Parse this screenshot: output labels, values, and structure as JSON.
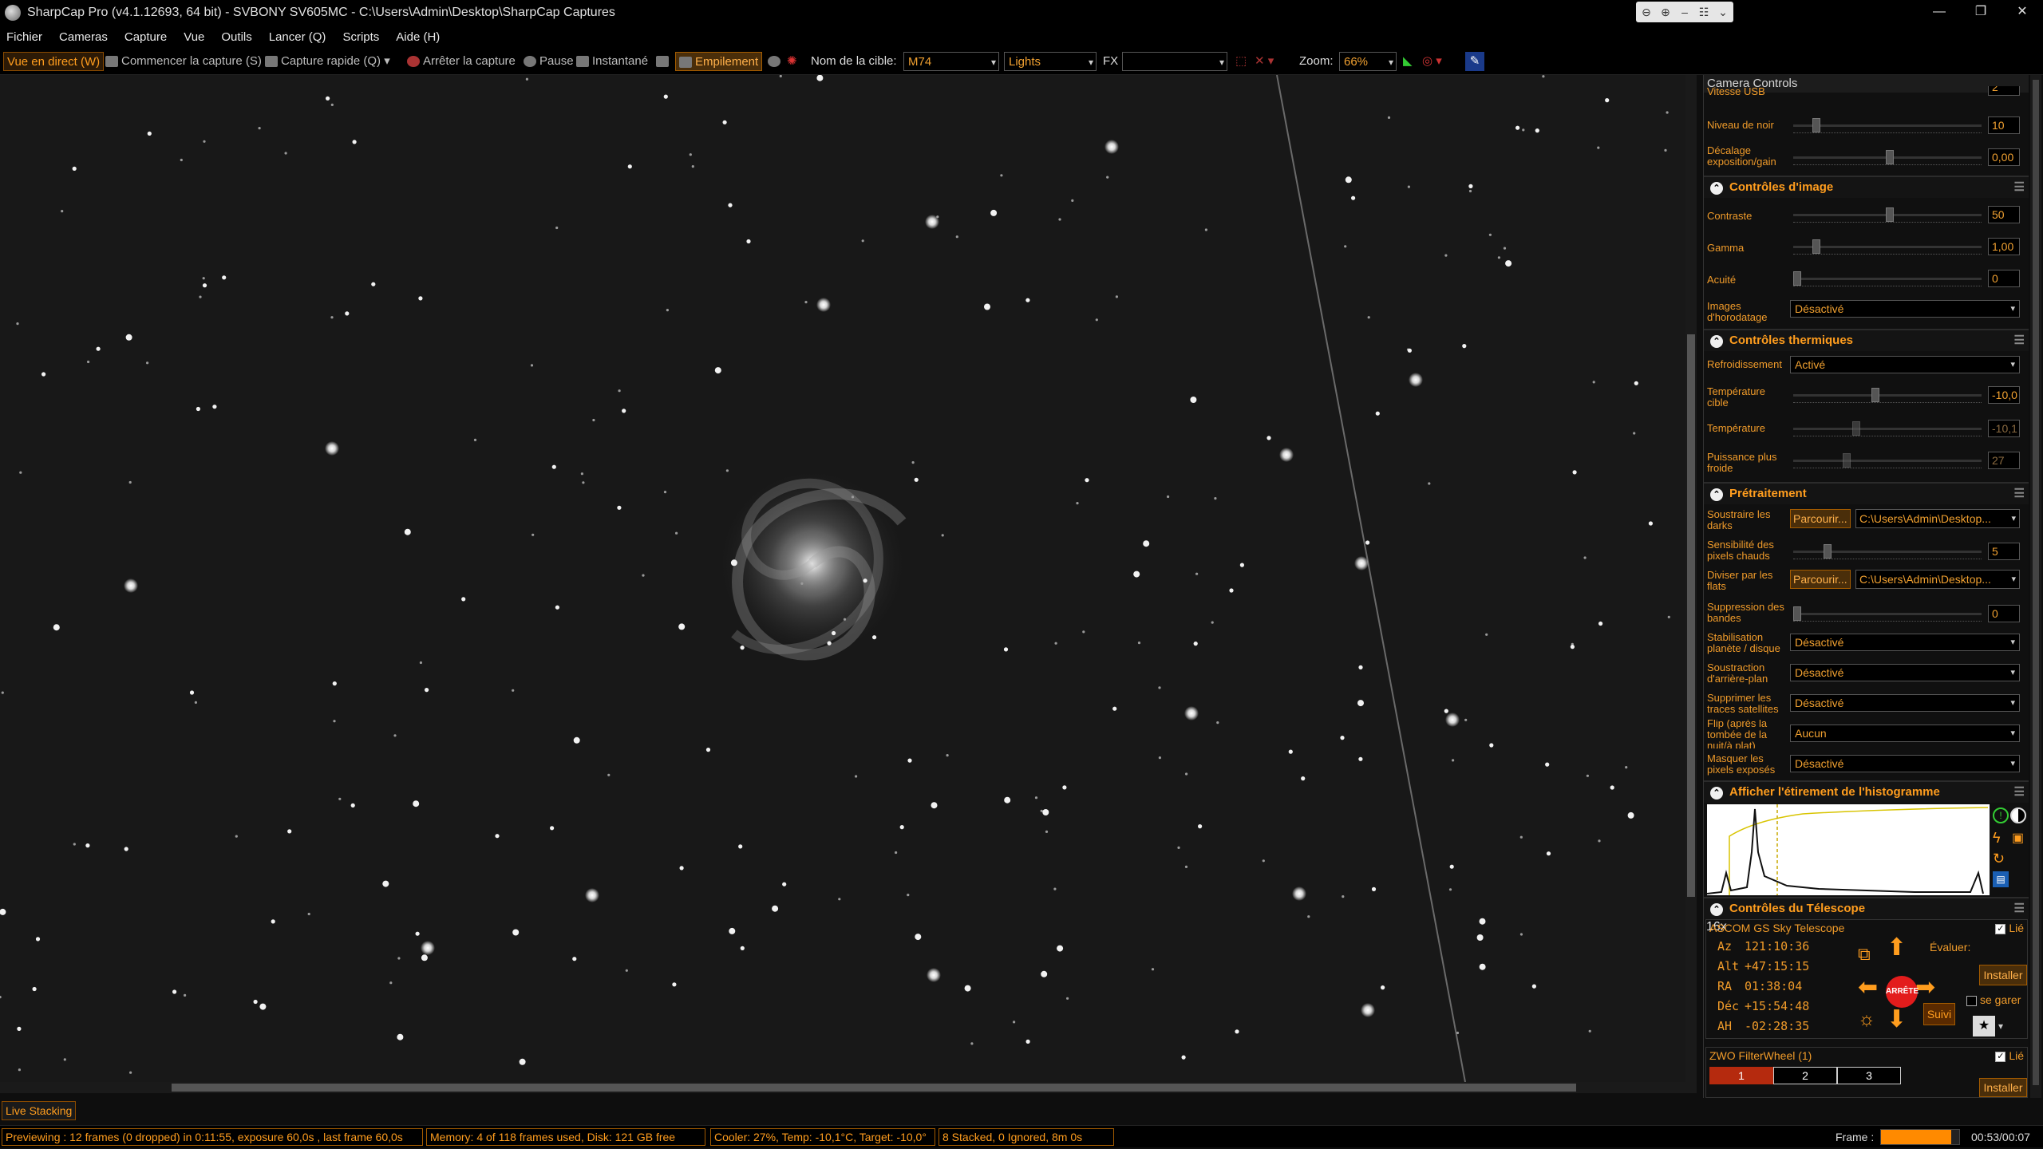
{
  "window": {
    "title": "SharpCap Pro (v4.1.12693, 64 bit) - SVBONY SV605MC - C:\\Users\\Admin\\Desktop\\SharpCap Captures",
    "controls": [
      "—",
      "❐",
      "✕"
    ]
  },
  "menu": [
    "Fichier",
    "Cameras",
    "Capture",
    "Vue",
    "Outils",
    "Lancer (Q)",
    "Scripts",
    "Aide (H)"
  ],
  "toolbar": {
    "live_view": "Vue en direct (W)",
    "start_capture": "Commencer la capture (S)",
    "quick_capture": "Capture rapide (Q)",
    "stop_capture": "Arrêter la capture",
    "pause": "Pause",
    "snapshot": "Instantané",
    "stacking": "Empilement",
    "target_label": "Nom de la cible:",
    "target_value": "M74",
    "frame_type": "Lights",
    "fx_label": "FX",
    "fx_value": "",
    "zoom_label": "Zoom:",
    "zoom_value": "66%"
  },
  "panel": {
    "title": "Camera Controls",
    "cut_off_label": "Vitesse USB",
    "cut_off_value": "2",
    "noir_label": "Niveau de noir",
    "noir_value": "10",
    "offset_label": "Décalage exposition/gain",
    "offset_value": "0,00",
    "image": {
      "header": "Contrôles d'image",
      "contraste_label": "Contraste",
      "contraste_value": "50",
      "gamma_label": "Gamma",
      "gamma_value": "1,00",
      "acuite_label": "Acuité",
      "acuite_value": "0",
      "horodatage_label": "Images d'horodatage",
      "horodatage_value": "Désactivé"
    },
    "thermal": {
      "header": "Contrôles thermiques",
      "refroid_label": "Refroidissement",
      "refroid_value": "Activé",
      "cible_label": "Température cible",
      "cible_value": "-10,0",
      "temp_label": "Température",
      "temp_value": "-10,1",
      "puissance_label": "Puissance plus froide",
      "puissance_value": "27"
    },
    "pre": {
      "header": "Prétraitement",
      "darks_label": "Soustraire les darks",
      "browse": "Parcourir...",
      "darks_path": "C:\\Users\\Admin\\Desktop...",
      "sens_label": "Sensibilité des pixels chauds",
      "sens_value": "5",
      "flats_label": "Diviser par les flats",
      "flats_path": "C:\\Users\\Admin\\Desktop...",
      "bandes_label": "Suppression des bandes",
      "bandes_value": "0",
      "stab_label": "Stabilisation planète / disque",
      "stab_value": "Désactivé",
      "arriere_label": "Soustraction d'arrière-plan",
      "arriere_value": "Désactivé",
      "sat_label": "Supprimer les traces satellites",
      "sat_value": "Désactivé",
      "flip_label": "Flip (après la tombée de la nuit/à plat)",
      "flip_value": "Aucun",
      "masq_label": "Masquer les pixels exposés",
      "masq_value": "Désactivé"
    },
    "histogram": {
      "header": "Afficher l'étirement de l'histogramme"
    },
    "telescope": {
      "header": "Contrôles du Télescope",
      "name": "ASCOM GS Sky Telescope",
      "linked": "Lié",
      "az_k": "Az",
      "az_v": "121:10:36",
      "alt_k": "Alt",
      "alt_v": "+47:15:15",
      "ra_k": "RA",
      "ra_v": "01:38:04",
      "dec_k": "Déc",
      "dec_v": "+15:54:48",
      "ah_k": "AH",
      "ah_v": "-02:28:35",
      "stop": "ARRÊTE",
      "rate_label": "Évaluer:",
      "rate_value": "16x",
      "install": "Installer",
      "park": "se garer",
      "track": "Suivi"
    },
    "filterwheel": {
      "name": "ZWO FilterWheel (1)",
      "linked": "Lié",
      "slots": [
        "1",
        "2",
        "3"
      ],
      "install": "Installer"
    }
  },
  "status": {
    "live_stacking": "Live Stacking",
    "previewing": "Previewing : 12 frames (0 dropped) in 0:11:55, exposure 60,0s , last frame 60,0s",
    "memory": "Memory: 4 of 118 frames used, Disk: 121 GB free",
    "cooler": "Cooler: 27%, Temp: -10,1°C, Target: -10,0°",
    "stacked": "8 Stacked, 0 Ignored, 8m 0s",
    "frame_label": "Frame :",
    "frame_progress": 0.9,
    "frame_time": "00:53/00:07"
  },
  "colors": {
    "accent": "#ff9d1e",
    "panel_bg": "#101010",
    "sky_bg": "#181818"
  }
}
